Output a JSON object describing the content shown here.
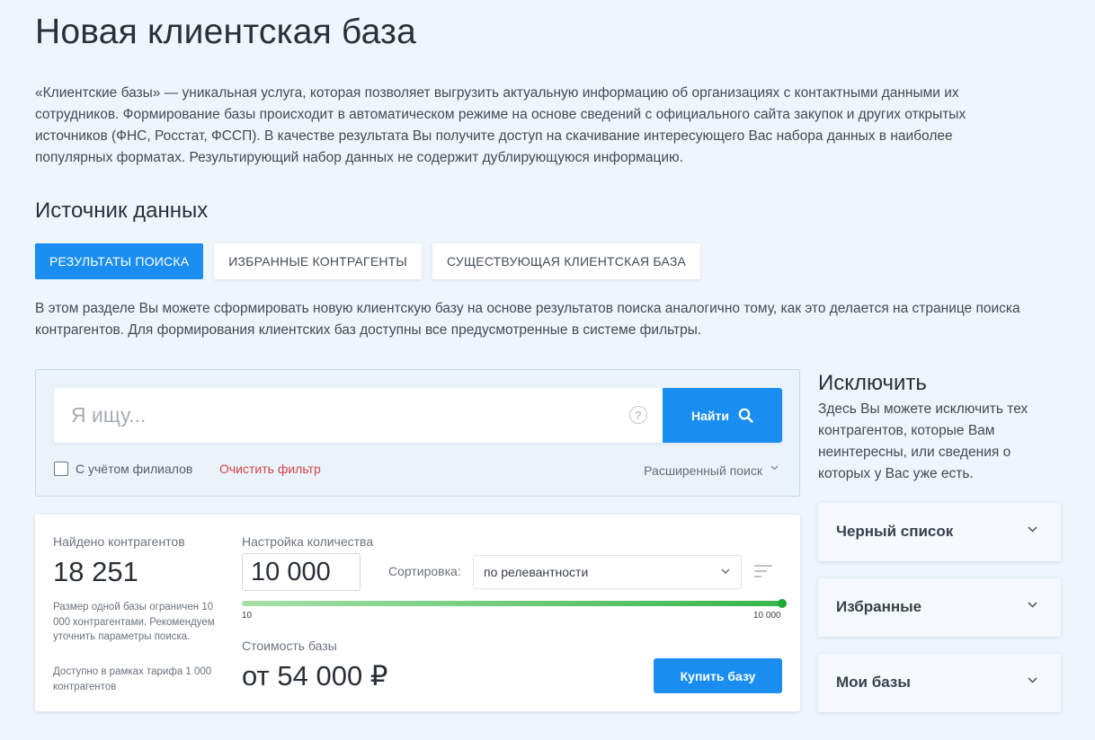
{
  "page": {
    "title": "Новая клиентская база",
    "intro": "«Клиентские базы» — уникальная услуга, которая позволяет выгрузить актуальную информацию об организациях с контактными данными их сотрудников. Формирование базы происходит в автоматическом режиме на основе сведений с официального сайта закупок и других открытых источников (ФНС, Росстат, ФССП). В качестве результата Вы получите доступ на скачивание интересующего Вас набора данных в наиболее популярных форматах. Результирующий набор данных не содержит дублирующуюся информацию."
  },
  "source": {
    "heading": "Источник данных",
    "tabs": [
      {
        "label": "Результаты поиска",
        "active": true
      },
      {
        "label": "Избранные контрагенты",
        "active": false
      },
      {
        "label": "Существующая клиентская база",
        "active": false
      }
    ],
    "description": "В этом разделе Вы можете сформировать новую клиентскую базу на основе результатов поиска аналогично тому, как это делается на странице поиска контрагентов. Для формирования клиентских баз доступны все предусмотренные в системе фильтры."
  },
  "search": {
    "placeholder": "Я ищу...",
    "value": "",
    "help": "?",
    "button_label": "Найти",
    "include_branches_label": "С учётом филиалов",
    "include_branches_checked": false,
    "clear_filter_label": "Очистить фильтр",
    "advanced_label": "Расширенный поиск"
  },
  "results": {
    "found_label": "Найдено контрагентов",
    "found_count": "18 251",
    "limit_note": "Размер одной базы ограничен 10 000 контрагентами. Рекомендуем уточнить параметры поиска.",
    "tariff_note": "Доступно в рамках тарифа 1 000 контрагентов",
    "quantity_label": "Настройка количества",
    "quantity_value": "10 000",
    "sort_label": "Сортировка:",
    "sort_value": "по релевантности",
    "slider": {
      "min_label": "10",
      "max_label": "10 000",
      "value": 10000,
      "fraction": 1.0
    },
    "price_label": "Стоимость базы",
    "price_value": "от 54 000 ₽",
    "buy_label": "Купить базу"
  },
  "exclude": {
    "heading": "Исключить",
    "description": "Здесь Вы можете исключить тех контрагентов, которые Вам неинтересны, или сведения о которых у Вас уже есть.",
    "sections": [
      {
        "title": "Черный список"
      },
      {
        "title": "Избранные"
      },
      {
        "title": "Мои базы"
      }
    ]
  },
  "colors": {
    "accent": "#1a8ef0",
    "background": "#eef5fb",
    "danger_link": "#d44545",
    "slider_start": "#a7e0a8",
    "slider_end": "#35b64a"
  },
  "icons": [
    "search-icon",
    "help-icon",
    "chevron-down-icon",
    "sort-icon"
  ]
}
